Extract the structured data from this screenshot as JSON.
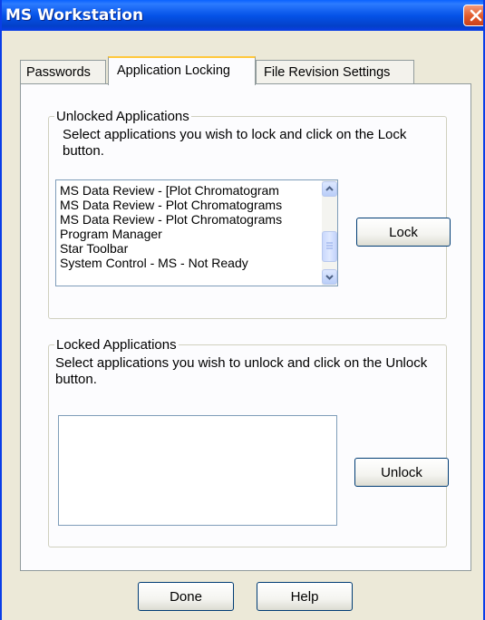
{
  "window": {
    "title": "MS Workstation"
  },
  "tabs": [
    {
      "label": "Passwords"
    },
    {
      "label": "Application Locking"
    },
    {
      "label": "File Revision Settings"
    }
  ],
  "unlocked": {
    "legend": "Unlocked Applications",
    "description": "Select applications you wish to lock and click on the Lock button.",
    "items": [
      "MS Data Review - [Plot Chromatogram",
      "MS Data Review - Plot Chromatograms",
      "MS Data Review - Plot Chromatograms",
      "Program Manager",
      "Star Toolbar",
      "System Control - MS - Not Ready"
    ],
    "lock_label": "Lock"
  },
  "locked": {
    "legend": "Locked Applications",
    "description": "Select applications you wish to unlock and click on the Unlock button.",
    "items": [],
    "unlock_label": "Unlock"
  },
  "footer": {
    "done_label": "Done",
    "help_label": "Help"
  }
}
